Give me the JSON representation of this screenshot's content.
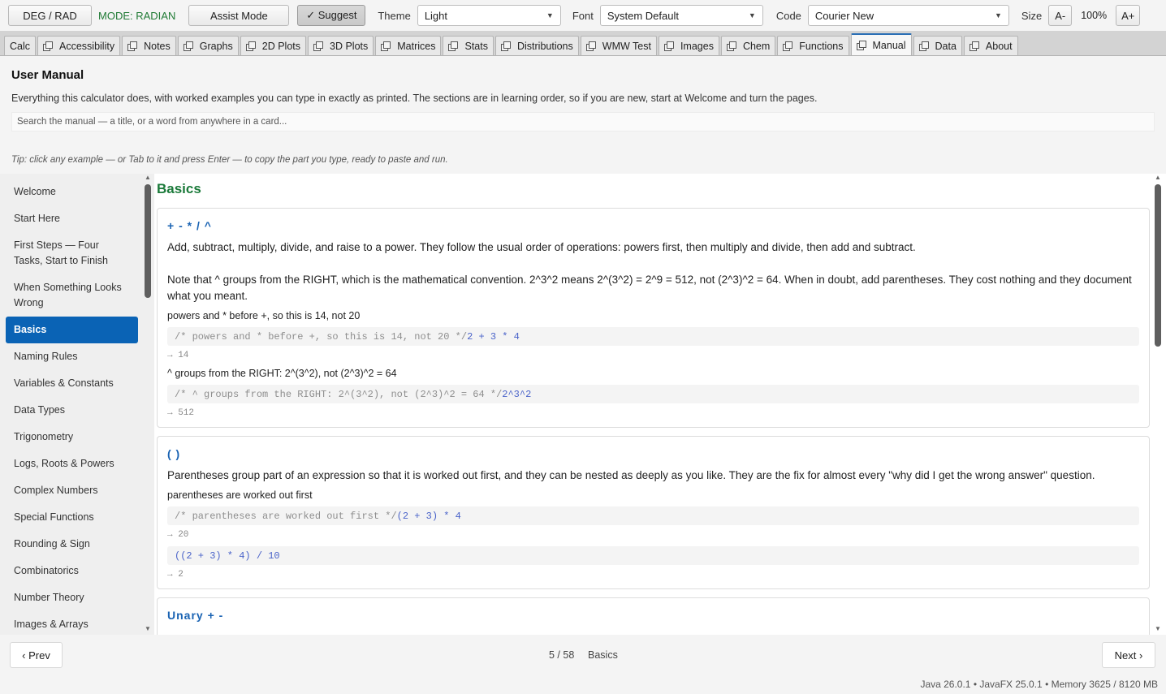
{
  "toolbar": {
    "angle_button": "DEG / RAD",
    "mode_label": "MODE: RADIAN",
    "assist_button": "Assist Mode",
    "suggest_button": "✓ Suggest",
    "theme_label": "Theme",
    "theme_value": "Light",
    "font_label": "Font",
    "font_value": "System Default",
    "code_label": "Code",
    "code_value": "Courier New",
    "size_label": "Size",
    "size_decrease": "A-",
    "zoom_level": "100%",
    "size_increase": "A+"
  },
  "tabs": [
    "Calc",
    "Accessibility",
    "Notes",
    "Graphs",
    "2D Plots",
    "3D Plots",
    "Matrices",
    "Stats",
    "Distributions",
    "WMW Test",
    "Images",
    "Chem",
    "Functions",
    "Manual",
    "Data",
    "About"
  ],
  "selected_tab": "Manual",
  "manual": {
    "title": "User Manual",
    "description": "Everything this calculator does, with worked examples you can type in exactly as printed. The sections are in learning order, so if you are new, start at Welcome and turn the pages.",
    "search_placeholder": "Search the manual — a title, or a word from anywhere in a card...",
    "tip": "Tip: click any example — or Tab to it and press Enter — to copy the part you type, ready to paste and run."
  },
  "nav": {
    "items": [
      "Welcome",
      "Start Here",
      "First Steps — Four Tasks, Start to Finish",
      "When Something Looks Wrong",
      "Basics",
      "Naming Rules",
      "Variables & Constants",
      "Data Types",
      "Trigonometry",
      "Logs, Roots & Powers",
      "Complex Numbers",
      "Special Functions",
      "Rounding & Sign",
      "Combinatorics",
      "Number Theory",
      "Images & Arrays"
    ],
    "selected": "Basics"
  },
  "section": {
    "title": "Basics",
    "cards": [
      {
        "heading": "+ - * / ^",
        "paragraphs": [
          "Add, subtract, multiply, divide, and raise to a power. They follow the usual order of operations: powers first, then multiply and divide, then add and subtract.",
          "Note that ^ groups from the RIGHT, which is the mathematical convention. 2^3^2 means 2^(3^2) = 2^9 = 512, not (2^3)^2 = 64. When in doubt, add parentheses. They cost nothing and they document what you meant."
        ],
        "examples": [
          {
            "label": "powers and * before +, so this is 14, not 20",
            "comment": "/* powers and * before +, so this is 14, not 20 */",
            "code": "2 + 3 * 4",
            "result": "→ 14"
          },
          {
            "label": "^ groups from the RIGHT: 2^(3^2), not (2^3)^2 = 64",
            "comment": "/* ^ groups from the RIGHT: 2^(3^2), not (2^3)^2 = 64 */",
            "code": "2^3^2",
            "result": "→ 512"
          }
        ]
      },
      {
        "heading": "( )",
        "paragraphs": [
          "Parentheses group part of an expression so that it is worked out first, and they can be nested as deeply as you like. They are the fix for almost every \"why did I get the wrong answer\" question."
        ],
        "examples": [
          {
            "label": "parentheses are worked out first",
            "comment": "/* parentheses are worked out first */",
            "code": "(2 + 3) * 4",
            "result": "→ 20"
          },
          {
            "label": "",
            "comment": "",
            "code": "((2 + 3) * 4) / 10",
            "result": "→ 2"
          }
        ]
      },
      {
        "heading": "Unary +  -",
        "paragraphs": []
      }
    ]
  },
  "footer": {
    "prev_button": "‹  Prev",
    "next_button": "Next  ›",
    "page_position": "5 / 58",
    "page_title": "Basics",
    "status": "Java 26.0.1  •  JavaFX 25.0.1  •  Memory 3625 / 8120 MB"
  }
}
